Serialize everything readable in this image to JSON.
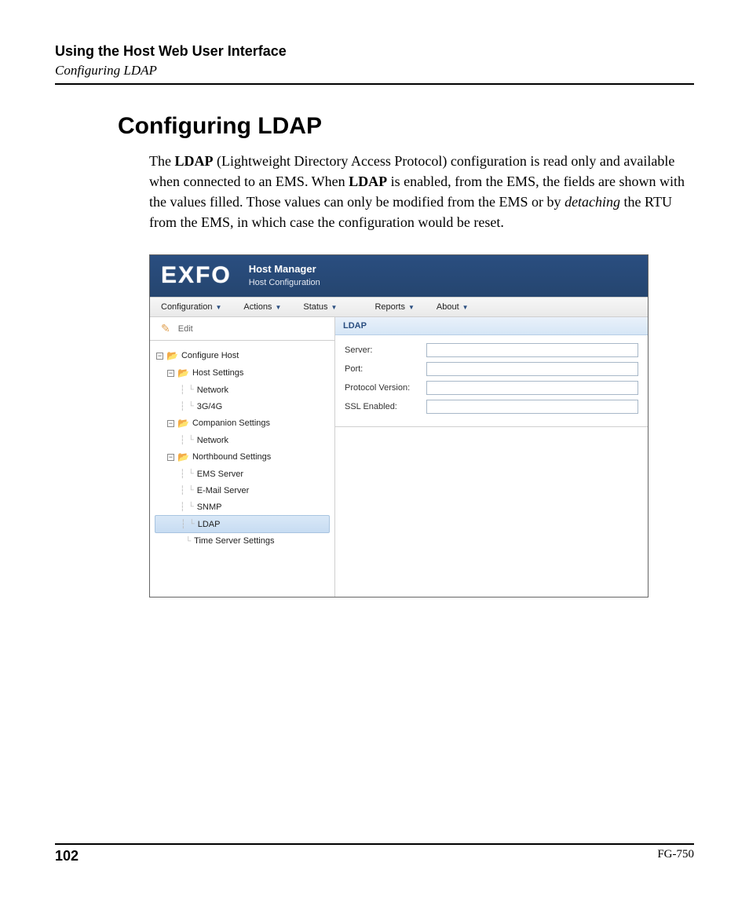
{
  "doc": {
    "chapter": "Using the Host Web User Interface",
    "breadcrumb": "Configuring LDAP",
    "section_title": "Configuring LDAP",
    "para_plain_1": "The ",
    "para_bold_1": "LDAP",
    "para_plain_2": " (Lightweight Directory Access Protocol) configuration is read only and available when connected to an EMS. When ",
    "para_bold_2": "LDAP",
    "para_plain_3": " is enabled, from the EMS, the fields are shown with the values filled. Those values can only be modified from the EMS or by ",
    "para_italic_1": "detaching",
    "para_plain_4": " the RTU from the EMS, in which case the configuration would be reset."
  },
  "app": {
    "logo": "EXFO",
    "title": "Host Manager",
    "subtitle": "Host Configuration",
    "menu": {
      "configuration": "Configuration",
      "actions": "Actions",
      "status": "Status",
      "reports": "Reports",
      "about": "About"
    },
    "sidebar": {
      "edit": "Edit",
      "configure_host": "Configure Host",
      "host_settings": "Host Settings",
      "network1": "Network",
      "g34g": "3G/4G",
      "companion_settings": "Companion Settings",
      "network2": "Network",
      "northbound_settings": "Northbound Settings",
      "ems_server": "EMS Server",
      "email_server": "E-Mail Server",
      "snmp": "SNMP",
      "ldap": "LDAP",
      "time_server": "Time Server Settings"
    },
    "form": {
      "head": "LDAP",
      "server_label": "Server:",
      "port_label": "Port:",
      "protocol_label": "Protocol Version:",
      "ssl_label": "SSL Enabled:",
      "server_value": "",
      "port_value": "",
      "protocol_value": "",
      "ssl_value": ""
    }
  },
  "footer": {
    "page": "102",
    "doc_id": "FG-750"
  }
}
